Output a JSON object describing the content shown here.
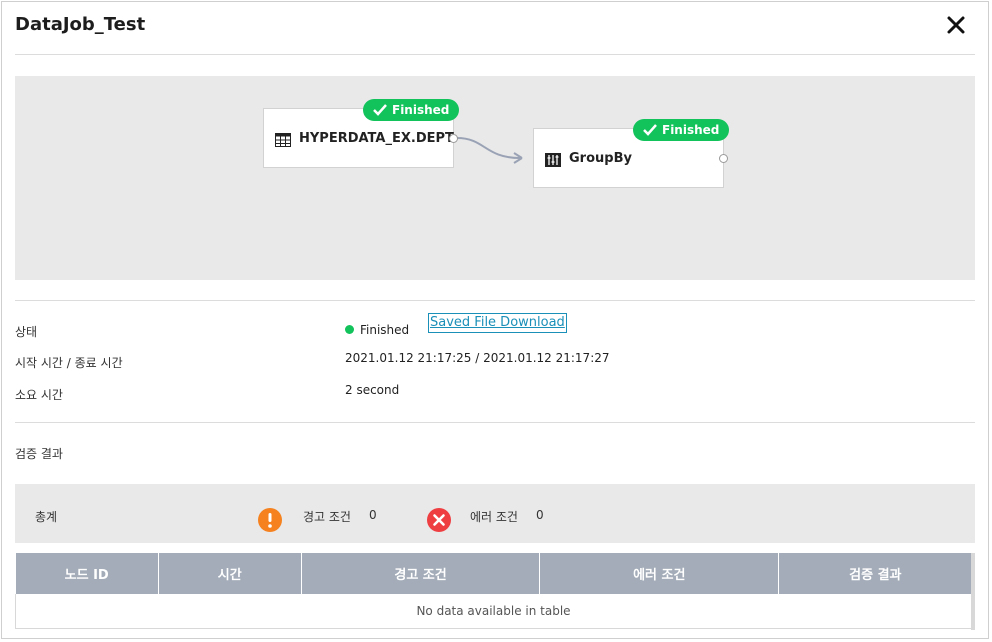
{
  "dialog": {
    "title": "DataJob_Test",
    "close_icon": "close-icon"
  },
  "workflow": {
    "nodes": [
      {
        "label": "HYPERDATA_EX.DEPT",
        "icon": "table-icon",
        "status": "Finished"
      },
      {
        "label": "GroupBy",
        "icon": "groupby-icon",
        "status": "Finished"
      }
    ],
    "status_color": "#12c25b"
  },
  "info": {
    "status_label": "상태",
    "status_value": "Finished",
    "download_label": "Saved File Download",
    "time_label": "시작 시간 / 종료 시간",
    "time_value": "2021.01.12 21:17:25 / 2021.01.12 21:17:27",
    "duration_label": "소요 시간",
    "duration_value": "2 second"
  },
  "validation": {
    "section_label": "검증 결과",
    "summary_label": "총계",
    "warning_label": "경고 조건",
    "warning_count": "0",
    "warning_color": "#f5821f",
    "error_label": "에러 조건",
    "error_count": "0",
    "error_color": "#ef3e42"
  },
  "table": {
    "columns": [
      "노드 ID",
      "시간",
      "경고 조건",
      "에러 조건",
      "검증 결과"
    ],
    "empty_text": "No data available in table"
  }
}
